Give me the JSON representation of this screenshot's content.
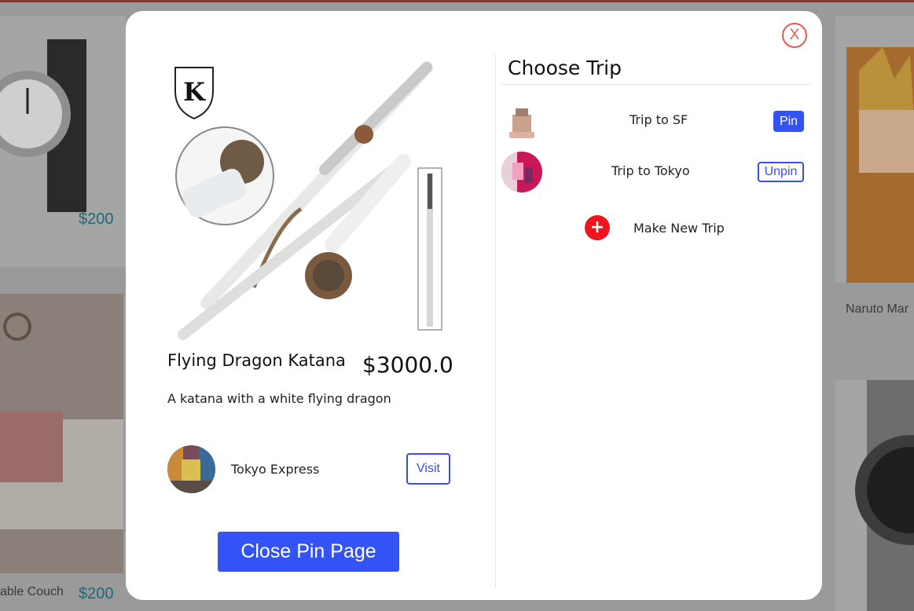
{
  "background": {
    "prices": [
      "$200",
      "$200"
    ],
    "labels": [
      "able Couch",
      "Naruto Mar"
    ]
  },
  "modal": {
    "close_label": "X",
    "product": {
      "title": "Flying Dragon Katana",
      "price": "$3000.0",
      "description": "A katana with a white flying dragon",
      "image_icon": "katana-product-image"
    },
    "store": {
      "name": "Tokyo Express",
      "visit_label": "Visit"
    },
    "close_page_label": "Close Pin Page",
    "trips": {
      "heading": "Choose Trip",
      "items": [
        {
          "name": "Trip to SF",
          "action": "Pin"
        },
        {
          "name": "Trip to Tokyo",
          "action": "Unpin"
        }
      ],
      "new_trip_label": "Make New Trip",
      "new_trip_icon": "+"
    }
  },
  "colors": {
    "accent": "#3353f7",
    "close": "#e8564f",
    "new_trip": "#f0141e"
  }
}
